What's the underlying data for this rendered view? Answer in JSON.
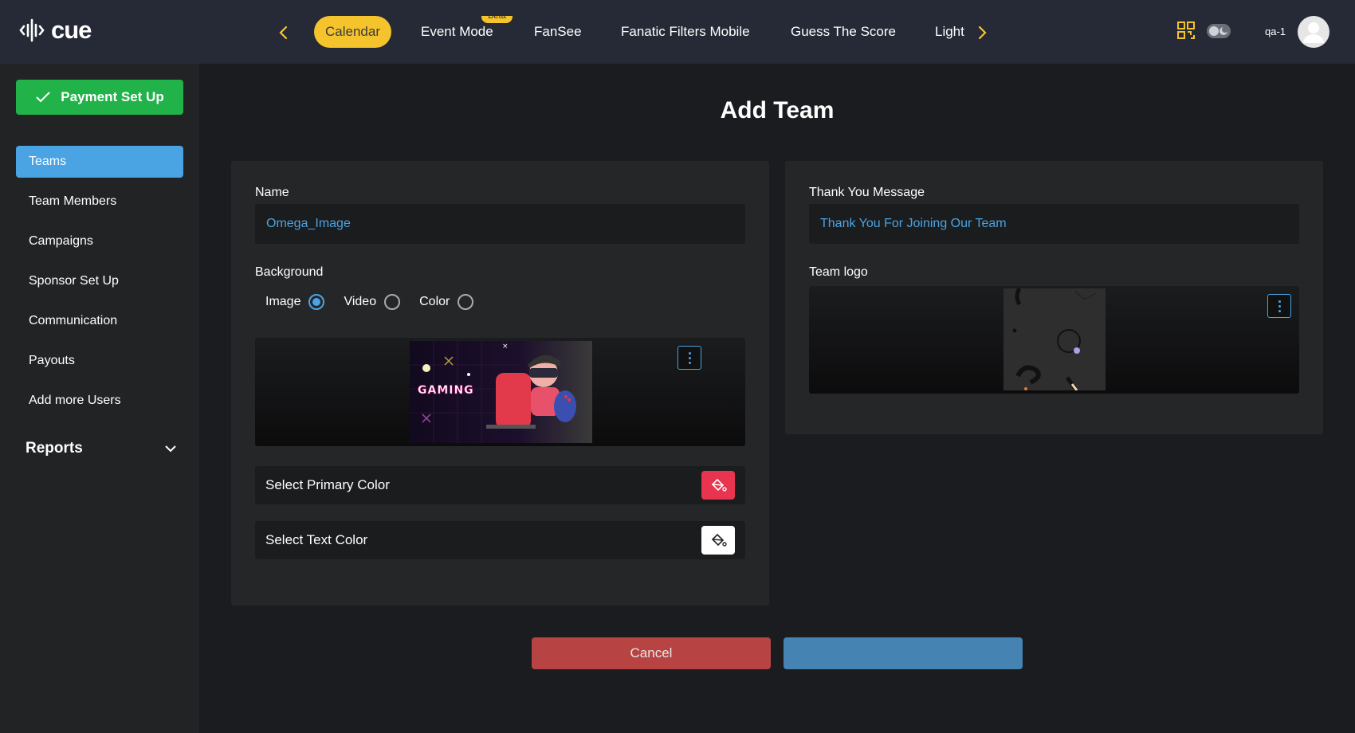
{
  "app": {
    "brand": "cue"
  },
  "nav": {
    "tabs": [
      {
        "label": "Calendar",
        "active": true
      },
      {
        "label": "Event Mode",
        "badge": "Beta"
      },
      {
        "label": "FanSee"
      },
      {
        "label": "Fanatic Filters Mobile"
      },
      {
        "label": "Guess The Score"
      },
      {
        "label": "Light"
      }
    ],
    "prev_icon": "chevron-left-icon",
    "next_icon": "chevron-right-icon"
  },
  "topbar": {
    "user_name": "qa-1",
    "qr_icon": "qr-code-icon",
    "theme_icon": "theme-toggle-icon"
  },
  "sidebar": {
    "payment_button": "Payment Set Up",
    "items": [
      {
        "label": "Teams",
        "active": true
      },
      {
        "label": "Team Members"
      },
      {
        "label": "Campaigns"
      },
      {
        "label": "Sponsor Set Up"
      },
      {
        "label": "Communication"
      },
      {
        "label": "Payouts"
      },
      {
        "label": "Add more Users"
      }
    ],
    "reports_label": "Reports"
  },
  "page": {
    "title": "Add Team"
  },
  "form": {
    "name_label": "Name",
    "name_value": "Omega_Image",
    "background_label": "Background",
    "background_options": [
      "Image",
      "Video",
      "Color"
    ],
    "background_selected": "Image",
    "background_image_text": "GAMING",
    "primary_color_label": "Select Primary Color",
    "primary_color": "#e8344e",
    "text_color_label": "Select Text Color",
    "text_color": "#ffffff",
    "thank_you_label": "Thank You Message",
    "thank_you_value": "Thank You For Joining Our Team",
    "team_logo_label": "Team logo"
  },
  "actions": {
    "cancel": "Cancel",
    "save": ""
  },
  "colors": {
    "accent": "#4aa3e2",
    "nav_active": "#f5c42c",
    "success": "#21b34a",
    "danger": "#b84343"
  }
}
